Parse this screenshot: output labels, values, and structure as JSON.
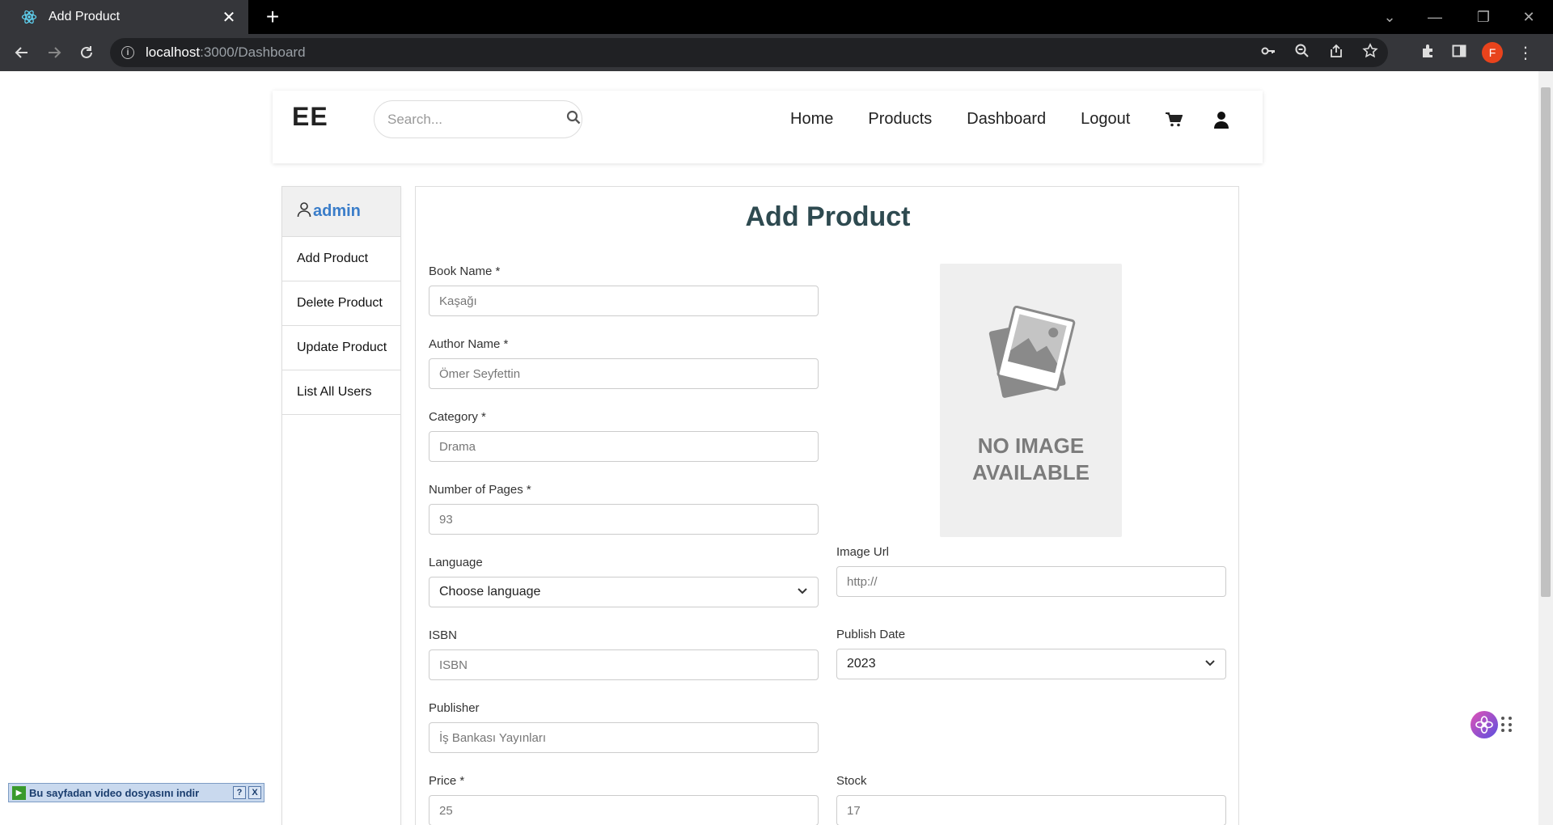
{
  "browser": {
    "tab_title": "Add Product",
    "url_host": "localhost",
    "url_path": ":3000/Dashboard",
    "profile_initial": "F"
  },
  "navbar": {
    "brand": "EE",
    "search_placeholder": "Search...",
    "links": [
      "Home",
      "Products",
      "Dashboard",
      "Logout"
    ]
  },
  "sidebar": {
    "user": "admin",
    "items": [
      "Add Product",
      "Delete Product",
      "Update Product",
      "List All Users"
    ]
  },
  "form": {
    "title": "Add Product",
    "book_name": {
      "label": "Book Name *",
      "placeholder": "Kaşağı"
    },
    "author_name": {
      "label": "Author Name *",
      "placeholder": "Ömer Seyfettin"
    },
    "category": {
      "label": "Category *",
      "placeholder": "Drama"
    },
    "pages": {
      "label": "Number of Pages *",
      "placeholder": "93"
    },
    "language": {
      "label": "Language",
      "value": "Choose language"
    },
    "isbn": {
      "label": "ISBN",
      "placeholder": "ISBN"
    },
    "publisher": {
      "label": "Publisher",
      "placeholder": "İş Bankası Yayınları"
    },
    "price": {
      "label": "Price *",
      "placeholder": "25"
    },
    "image_url": {
      "label": "Image Url",
      "placeholder": "http://"
    },
    "publish_date": {
      "label": "Publish Date",
      "value": "2023"
    },
    "stock": {
      "label": "Stock",
      "placeholder": "17"
    },
    "no_image_text": "NO IMAGE\nAVAILABLE"
  },
  "extension_bar": {
    "text": "Bu sayfadan video dosyasını indir",
    "help": "?",
    "close": "X"
  },
  "colors": {
    "accent_user": "#3a7dc9",
    "title": "#2e4a50",
    "profile": "#e8431c"
  }
}
